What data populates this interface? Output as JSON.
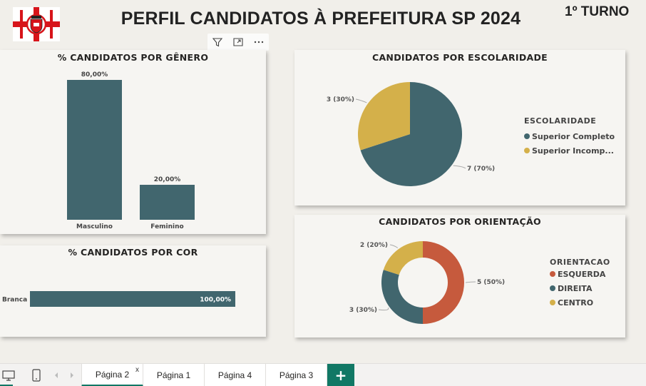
{
  "header": {
    "title": "PERFIL CANDIDATOS À PREFEITURA SP 2024",
    "turno": "1º TURNO"
  },
  "colors": {
    "teal": "#41666e",
    "gold": "#d4b04a",
    "red": "#c65a3d",
    "accent": "#117865"
  },
  "visual_toolbar": {
    "icons": [
      "filter-icon",
      "focus-mode-icon",
      "more-options-icon"
    ]
  },
  "gender_chart": {
    "title": "% CANDIDATOS POR GÊNERO",
    "chart_data": {
      "type": "bar",
      "categories": [
        "Masculino",
        "Feminino"
      ],
      "values": [
        80,
        20
      ],
      "value_labels": [
        "80,00%",
        "20,00%"
      ],
      "ylim": [
        0,
        80
      ]
    }
  },
  "color_chart": {
    "title": "% CANDIDATOS POR COR",
    "chart_data": {
      "type": "bar",
      "orientation": "horizontal",
      "categories": [
        "Branca"
      ],
      "values": [
        100
      ],
      "value_labels": [
        "100,00%"
      ],
      "xlim": [
        0,
        100
      ]
    }
  },
  "education_chart": {
    "title": "CANDIDATOS POR ESCOLARIDADE",
    "legend_title": "ESCOLARIDADE",
    "chart_data": {
      "type": "pie",
      "slices": [
        {
          "label": "Superior Completo",
          "legend_label": "Superior Completo",
          "value": 7,
          "data_label": "7 (70%)",
          "color": "#41666e"
        },
        {
          "label": "Superior Incompleto",
          "legend_label": "Superior Incomp...",
          "value": 3,
          "data_label": "3 (30%)",
          "color": "#d4b04a"
        }
      ]
    }
  },
  "orientation_chart": {
    "title": "CANDIDATOS POR ORIENTAÇÃO",
    "legend_title": "ORIENTACAO",
    "chart_data": {
      "type": "donut",
      "slices": [
        {
          "label": "ESQUERDA",
          "value": 5,
          "data_label": "5 (50%)",
          "color": "#c65a3d"
        },
        {
          "label": "DIREITA",
          "value": 3,
          "data_label": "3 (30%)",
          "color": "#41666e"
        },
        {
          "label": "CENTRO",
          "value": 2,
          "data_label": "2 (20%)",
          "color": "#d4b04a"
        }
      ]
    }
  },
  "tabs": [
    {
      "label": "Página 2",
      "active": true
    },
    {
      "label": "Página 1",
      "active": false
    },
    {
      "label": "Página 4",
      "active": false
    },
    {
      "label": "Página 3",
      "active": false
    }
  ],
  "tab_close": "x",
  "add_tab": "+"
}
